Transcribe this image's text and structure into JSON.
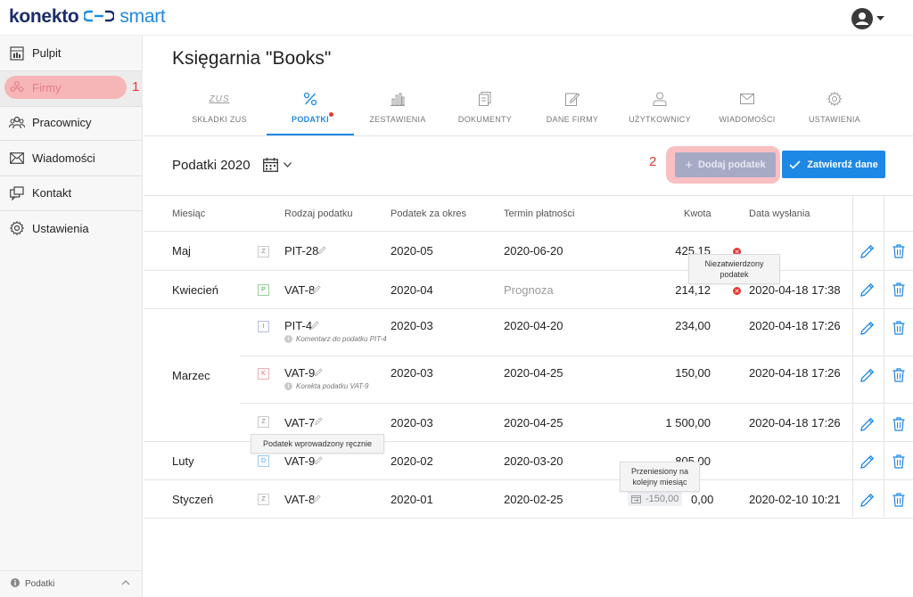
{
  "app": {
    "logo_left": "konekto",
    "logo_right": "smart"
  },
  "sidebar": {
    "items": [
      {
        "label": "Pulpit",
        "icon": "dashboard-icon"
      },
      {
        "label": "Firmy",
        "icon": "companies-icon"
      },
      {
        "label": "Pracownicy",
        "icon": "employees-icon"
      },
      {
        "label": "Wiadomości",
        "icon": "mail-icon"
      },
      {
        "label": "Kontakt",
        "icon": "contact-icon"
      },
      {
        "label": "Ustawienia",
        "icon": "gear-icon"
      }
    ],
    "footer_label": "Podatki"
  },
  "annotations": {
    "one": "1",
    "two": "2"
  },
  "page": {
    "title": "Księgarnia \"Books\""
  },
  "tabs": [
    {
      "label": "SKŁADKI ZUS",
      "icon_text": "ZUS"
    },
    {
      "label": "PODATKI"
    },
    {
      "label": "ZESTAWIENIA"
    },
    {
      "label": "DOKUMENTY"
    },
    {
      "label": "DANE FIRMY"
    },
    {
      "label": "UŻYTKOWNICY"
    },
    {
      "label": "WIADOMOŚCI"
    },
    {
      "label": "USTAWIENIA"
    }
  ],
  "toolbar": {
    "year_title": "Podatki 2020",
    "add_label": "Dodaj podatek",
    "confirm_label": "Zatwierdź dane"
  },
  "table": {
    "headers": [
      "Miesiąc",
      "Rodzaj podatku",
      "Podatek za okres",
      "Termin płatności",
      "Kwota",
      "Data wysłania"
    ],
    "rows": [
      {
        "month": "Maj",
        "badge": "Z",
        "type": "PIT-28",
        "period": "2020-05",
        "due": "2020-06-20",
        "amount": "425,15",
        "sent": ""
      },
      {
        "month": "Kwiecień",
        "badge": "P",
        "type": "VAT-8",
        "period": "2020-04",
        "due": "Prognoza",
        "amount": "214,12",
        "sent": "2020-04-18 17:38"
      },
      {
        "month": "Marzec",
        "badge": "I",
        "type": "PIT-4",
        "note": "Komentarz do podatku PIT-4",
        "period": "2020-03",
        "due": "2020-04-20",
        "amount": "234,00",
        "sent": "2020-04-18 17:26"
      },
      {
        "month": "",
        "badge": "K",
        "type": "VAT-9",
        "note": "Korekta podatku VAT-9",
        "period": "2020-03",
        "due": "2020-04-25",
        "amount": "150,00",
        "sent": "2020-04-18 17:26"
      },
      {
        "month": "",
        "badge": "Z",
        "type": "VAT-7",
        "period": "2020-03",
        "due": "2020-04-25",
        "amount": "1 500,00",
        "sent": "2020-04-18 17:26"
      },
      {
        "month": "Luty",
        "badge": "D",
        "type": "VAT-9",
        "period": "2020-02",
        "due": "2020-03-20",
        "amount": "805,00",
        "sent": ""
      },
      {
        "month": "Styczeń",
        "badge": "Z",
        "type": "VAT-8",
        "period": "2020-01",
        "due": "2020-02-25",
        "amount": "0,00",
        "moved_amount": "-150,00",
        "sent": "2020-02-10 10:21"
      }
    ]
  },
  "tooltips": {
    "unconfirmed": "Niezatwierdzony podatek",
    "manual": "Podatek wprowadzony ręcznie",
    "moved": "Przeniesiony na kolejny miesiąc"
  }
}
